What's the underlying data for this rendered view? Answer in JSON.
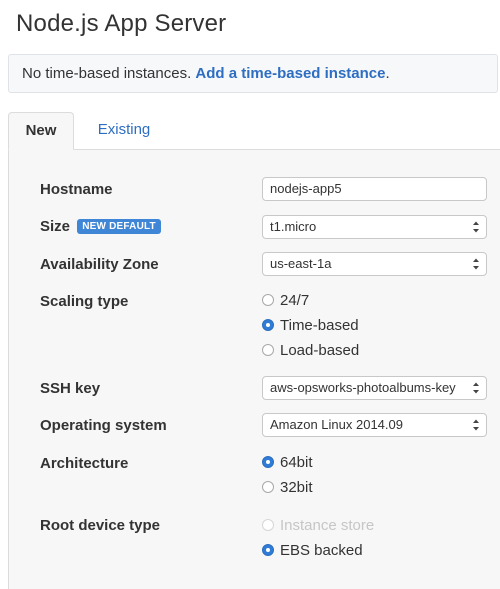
{
  "page_title": "Node.js App Server",
  "info_bar": {
    "text": "No time-based instances. ",
    "link": "Add a time-based instance",
    "suffix": "."
  },
  "tabs": [
    {
      "label": "New",
      "active": true
    },
    {
      "label": "Existing",
      "active": false
    }
  ],
  "form": {
    "hostname": {
      "label": "Hostname",
      "value": "nodejs-app5"
    },
    "size": {
      "label": "Size",
      "badge": "NEW DEFAULT",
      "value": "t1.micro"
    },
    "availability_zone": {
      "label": "Availability Zone",
      "value": "us-east-1a"
    },
    "scaling_type": {
      "label": "Scaling type",
      "options": [
        {
          "label": "24/7",
          "checked": false
        },
        {
          "label": "Time-based",
          "checked": true
        },
        {
          "label": "Load-based",
          "checked": false
        }
      ]
    },
    "ssh_key": {
      "label": "SSH key",
      "value": "aws-opsworks-photoalbums-key"
    },
    "operating_system": {
      "label": "Operating system",
      "value": "Amazon Linux 2014.09"
    },
    "architecture": {
      "label": "Architecture",
      "options": [
        {
          "label": "64bit",
          "checked": true
        },
        {
          "label": "32bit",
          "checked": false
        }
      ]
    },
    "root_device_type": {
      "label": "Root device type",
      "options": [
        {
          "label": "Instance store",
          "checked": false,
          "disabled": true
        },
        {
          "label": "EBS backed",
          "checked": true
        }
      ]
    }
  },
  "colors": {
    "link": "#2e6ec2",
    "badge": "#3f86d6",
    "radio_checked": "#2f7cd6"
  }
}
